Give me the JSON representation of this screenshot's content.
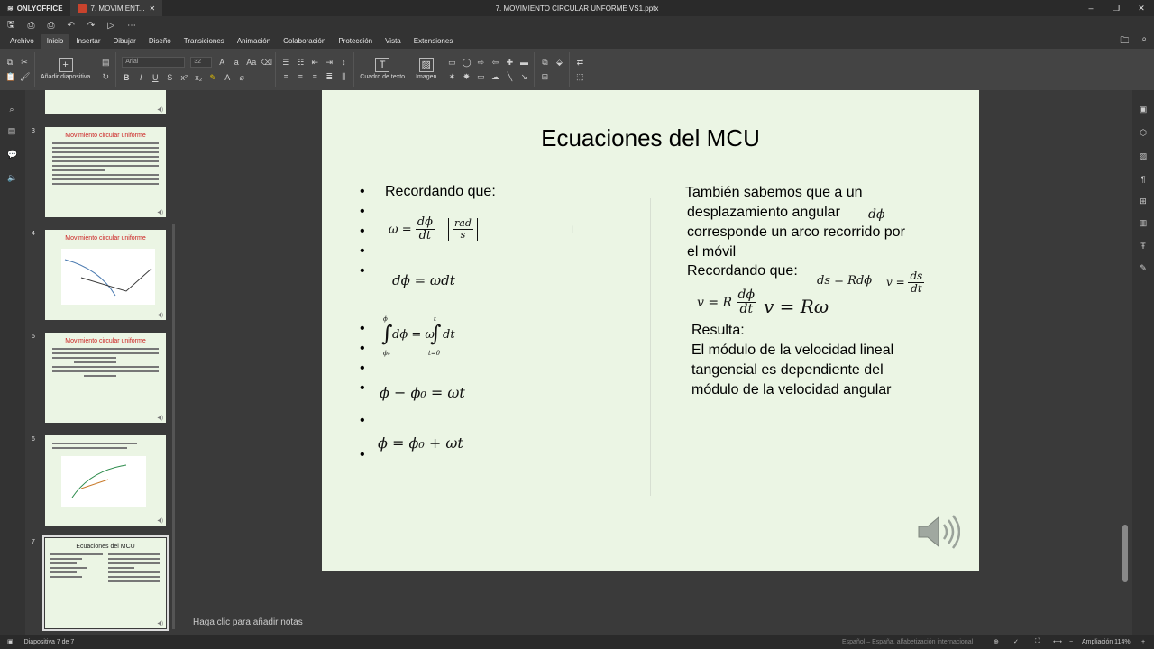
{
  "app": {
    "brand": "ONLYOFFICE",
    "tab_title": "7. MOVIMIENT...",
    "window_title": "7. MOVIMIENTO CIRCULAR UNFORME VS1.pptx"
  },
  "menu": {
    "tabs": [
      "Archivo",
      "Inicio",
      "Insertar",
      "Dibujar",
      "Diseño",
      "Transiciones",
      "Animación",
      "Colaboración",
      "Protección",
      "Vista",
      "Extensiones"
    ],
    "active": "Inicio"
  },
  "ribbon": {
    "add_slide_label": "Añadir diapositiva",
    "font_name": "Arial",
    "font_size": "32",
    "textbox_label": "Cuadro de texto",
    "image_label": "Imagen"
  },
  "thumbnails": [
    {
      "num": "3",
      "title": "Movimiento circular uniforme"
    },
    {
      "num": "4",
      "title": "Movimiento circular uniforme"
    },
    {
      "num": "5",
      "title": "Movimiento circular uniforme"
    },
    {
      "num": "6",
      "title": ""
    },
    {
      "num": "7",
      "title": "Ecuaciones del MCU"
    }
  ],
  "slide": {
    "title": "Ecuaciones del MCU",
    "left_intro": "Recordando que:",
    "eq_omega_lhs": "ω =",
    "eq_omega_num": "dϕ",
    "eq_omega_den": "dt",
    "eq_units_num": "rad",
    "eq_units_den": "s",
    "eq_dphi": "dϕ = ωdt",
    "eq_integral": "dϕ = ω",
    "eq_integral_dt": "dt",
    "eq_integral_lower1": "ϕ₀",
    "eq_integral_upper1": "ϕ",
    "eq_integral_lower2": "t=0",
    "eq_integral_upper2": "t",
    "eq_diff": "ϕ − ϕ₀ = ωt",
    "eq_final": "ϕ = ϕ₀ + ωt",
    "right_p1_l1": "También sabemos que a un",
    "right_p1_l2": "desplazamiento angular",
    "right_p1_dphi": "dϕ",
    "right_p1_l3": "corresponde un arco recorrido por",
    "right_p1_l4": "el móvil",
    "right_p2": "Recordando que:",
    "right_ds": "ds = Rdϕ",
    "right_v_lhs": "v =",
    "right_v_num": "ds",
    "right_v_den": "dt",
    "right_vR_lhs": "v = R",
    "right_vR_num": "dϕ",
    "right_vR_den": "dt",
    "right_vRw": "v = Rω",
    "right_result": "Resulta:",
    "right_r1": "El módulo de la  velocidad lineal",
    "right_r2": "tangencial es dependiente del",
    "right_r3": "módulo de la velocidad angular"
  },
  "notes_placeholder": "Haga clic para añadir notas",
  "status": {
    "slide_count": "Diapositiva 7 de 7",
    "language": "Español – España, alfabetización internacional",
    "zoom": "Ampliación 114%"
  }
}
